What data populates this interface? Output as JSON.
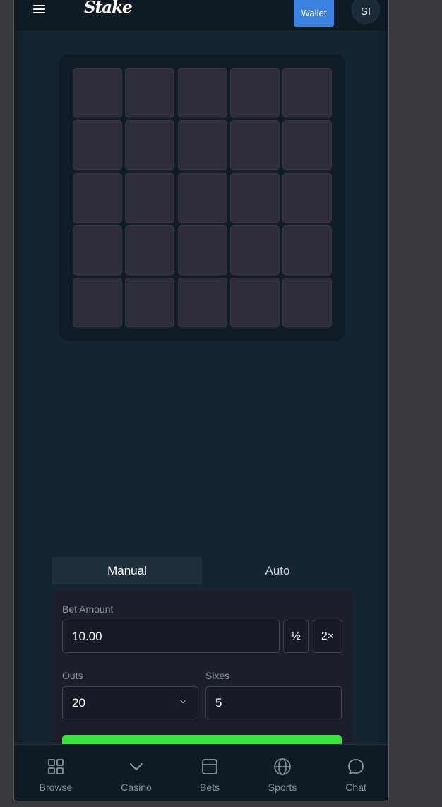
{
  "topbar": {
    "logo": "Stake",
    "wallet_label": "Wallet",
    "avatar_initials": "SI"
  },
  "board": {
    "rows": 5,
    "cols": 5
  },
  "tabs": [
    {
      "label": "Manual",
      "active": true
    },
    {
      "label": "Auto",
      "active": false
    }
  ],
  "bet": {
    "amount_label": "Bet Amount",
    "amount_value": "10.00",
    "half_label": "½",
    "double_label": "2×"
  },
  "outs": {
    "label": "Outs",
    "value": "20"
  },
  "sixes": {
    "label": "Sixes",
    "value": "5"
  },
  "nav": [
    {
      "label": "Browse",
      "icon": "grid-icon"
    },
    {
      "label": "Casino",
      "icon": "chevron-down-icon"
    },
    {
      "label": "Bets",
      "icon": "bets-icon"
    },
    {
      "label": "Sports",
      "icon": "globe-icon"
    },
    {
      "label": "Chat",
      "icon": "chat-bubble-icon"
    }
  ],
  "colors": {
    "accent_blue": "#3d82e0",
    "play_green": "#39e23f",
    "tile": "#2e2e3a",
    "background": "#13202a"
  }
}
